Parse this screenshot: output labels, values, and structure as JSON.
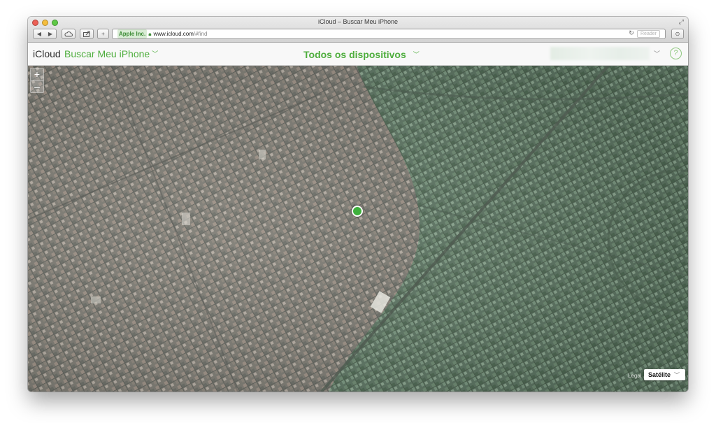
{
  "window": {
    "title": "iCloud – Buscar Meu iPhone"
  },
  "toolbar": {
    "back_glyph": "◀",
    "forward_glyph": "▶",
    "add_glyph": "+",
    "address": {
      "org_badge": "Apple Inc.",
      "host": "www.icloud.com",
      "path": "/#find"
    },
    "reader_label": "Reader"
  },
  "app": {
    "brand": "iCloud",
    "app_name": "Buscar Meu iPhone",
    "device_selector": "Todos os dispositivos",
    "help_glyph": "?"
  },
  "map": {
    "zoom_in": "+",
    "zoom_out": "–",
    "legal": "Legal",
    "map_type": "Satélite",
    "pin_color": "#3eb03c"
  },
  "icons": {
    "close": "close-icon",
    "minimize": "minimize-icon",
    "zoom": "zoom-window-icon",
    "fullscreen": "fullscreen-icon",
    "cloud": "icloud-tabs-icon",
    "share": "share-icon",
    "lock": "lock-icon",
    "reload": "reload-icon",
    "download": "downloads-icon",
    "apple": "apple-logo-icon"
  }
}
